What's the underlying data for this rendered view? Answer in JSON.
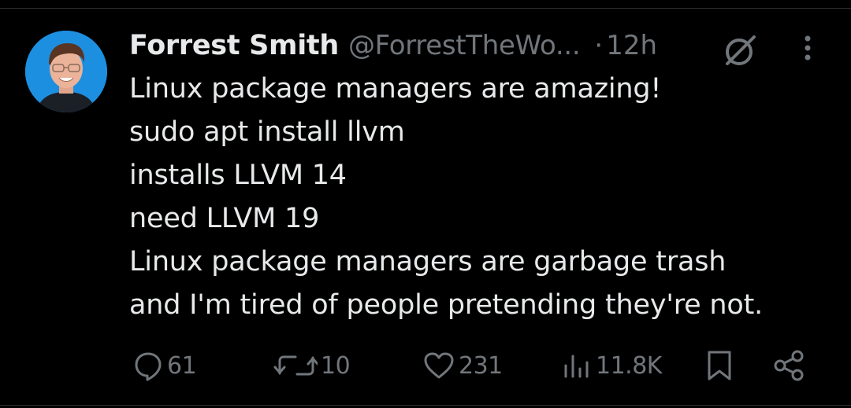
{
  "tweet": {
    "author_name": "Forrest Smith",
    "author_handle": "@ForrestTheWo...",
    "separator": "·",
    "time": "12h",
    "lines": [
      "Linux package managers are amazing!",
      "sudo apt install llvm",
      "installs LLVM 14",
      "need LLVM 19",
      "Linux package managers are garbage trash",
      "and I'm tired of people pretending they're not."
    ]
  },
  "actions": {
    "replies": "61",
    "reposts": "10",
    "likes": "231",
    "views": "11.8K"
  },
  "icons": {
    "avatar": "profile-photo",
    "grok": "grok-icon",
    "more": "more-vertical-icon",
    "reply": "speech-bubble-icon",
    "repost": "repost-arrows-icon",
    "like": "heart-icon",
    "views": "bar-chart-icon",
    "bookmark": "bookmark-icon",
    "share": "share-icon"
  },
  "colors": {
    "background": "#000000",
    "text_primary": "#e7e9ea",
    "text_secondary": "#71767b",
    "divider": "#2f3336",
    "avatar_bg": "#1d8fe0"
  }
}
